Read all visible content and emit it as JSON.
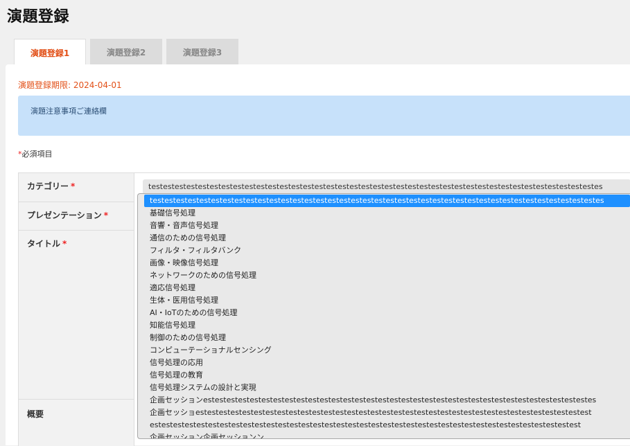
{
  "page": {
    "title": "演題登録"
  },
  "tabs": [
    {
      "label": "演題登録1",
      "active": true
    },
    {
      "label": "演題登録2",
      "active": false
    },
    {
      "label": "演題登録3",
      "active": false
    }
  ],
  "panel": {
    "deadline": "演題登録期限: 2024-04-01",
    "notice": "演題注意事項ご連絡欄",
    "required_note": {
      "asterisk": "*",
      "text": "必須項目"
    }
  },
  "form": {
    "rows": [
      {
        "label": "カテゴリー",
        "required": "*"
      },
      {
        "label": "プレゼンテーション",
        "required": "*"
      },
      {
        "label": "タイトル",
        "required": "*"
      },
      {
        "label": "概要",
        "required": ""
      }
    ],
    "category_select": {
      "selected_value": "testestestestestestestestestestestestestestestestestestestestestestestestestestestestestestestestestestestestestestes"
    }
  },
  "category_dropdown": {
    "options": [
      {
        "label": "testestestestestestestestestestestestestestestestestestestestestestestestestestestestestestestestestestestestestestes",
        "selected": true
      },
      {
        "label": "基礎信号処理"
      },
      {
        "label": "音響・音声信号処理"
      },
      {
        "label": "通信のための信号処理"
      },
      {
        "label": "フィルタ・フィルタバンク"
      },
      {
        "label": "画像・映像信号処理"
      },
      {
        "label": "ネットワークのための信号処理"
      },
      {
        "label": "適応信号処理"
      },
      {
        "label": "生体・医用信号処理"
      },
      {
        "label": "AI・IoTのための信号処理"
      },
      {
        "label": "知能信号処理"
      },
      {
        "label": "制御のための信号処理"
      },
      {
        "label": "コンピューテーショナルセンシング"
      },
      {
        "label": "信号処理の応用"
      },
      {
        "label": "信号処理の教育"
      },
      {
        "label": "信号処理システムの設計と実現"
      },
      {
        "label": "企画セッションestestestestestestestestestestestestestestestestestestestestestestestestestestestestestestestestestes"
      },
      {
        "label_line1": "企画セッショestestestestestestestestestestestestestestestestestestestestestestestestestestestestestestestestestest",
        "label_line2": "estestestestestestestestestestestestestestestestestestestestestestestestestestestestestestestestestestestestest"
      },
      {
        "label": "企画セッション企画セッションン"
      }
    ]
  },
  "colors": {
    "accent_orange": "#e25018",
    "notice_bg": "#c7e1fa",
    "selected_option_bg": "#1e90ff",
    "required_red": "#e22"
  }
}
